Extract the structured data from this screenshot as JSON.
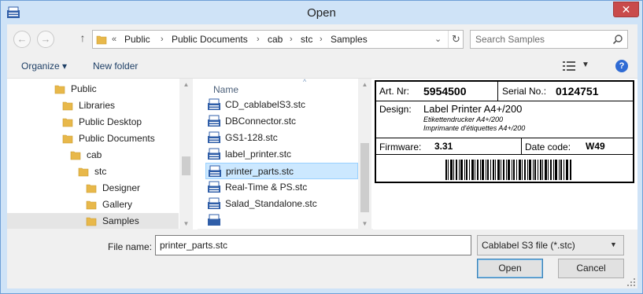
{
  "window": {
    "title": "Open",
    "close_glyph": "✕"
  },
  "address_bar": {
    "back_glyph": "←",
    "forward_glyph": "→",
    "up_glyph": "↑",
    "overflow_glyph": "«",
    "separator_glyph": "›",
    "crumbs": [
      "Public",
      "Public Documents",
      "cab",
      "stc",
      "Samples"
    ],
    "dropdown_glyph": "⌄",
    "refresh_glyph": "↻"
  },
  "search": {
    "placeholder": "Search Samples"
  },
  "toolbar": {
    "organize_label": "Organize ▾",
    "new_folder_label": "New folder",
    "view_dropdown_glyph": "▼",
    "help_glyph": "?"
  },
  "nav_tree": {
    "items": [
      {
        "label": "Public"
      },
      {
        "label": "Libraries"
      },
      {
        "label": "Public Desktop"
      },
      {
        "label": "Public Documents"
      },
      {
        "label": "cab"
      },
      {
        "label": "stc"
      },
      {
        "label": "Designer"
      },
      {
        "label": "Gallery"
      },
      {
        "label": "Samples",
        "selected": true
      }
    ],
    "scroll_up_glyph": "▲",
    "scroll_down_glyph": "▼"
  },
  "file_list": {
    "column_name": "Name",
    "sort_glyph": "^",
    "files": [
      {
        "name": "CD_cablabelS3.stc"
      },
      {
        "name": "DBConnector.stc"
      },
      {
        "name": "GS1-128.stc"
      },
      {
        "name": "label_printer.stc"
      },
      {
        "name": "printer_parts.stc",
        "selected": true
      },
      {
        "name": "Real-Time & PS.stc"
      },
      {
        "name": "Salad_Standalone.stc"
      }
    ],
    "scroll_up_glyph": "▲",
    "scroll_down_glyph": "▼"
  },
  "preview": {
    "art_label": "Art. Nr:",
    "art_value": "5954500",
    "serial_label": "Serial No.:",
    "serial_value": "0124751",
    "design_label": "Design:",
    "design_title": "Label Printer A4+/200",
    "design_de": "Etikettendrucker A4+/200",
    "design_fr": "Imprimante d'étiquettes A4+/200",
    "firmware_label": "Firmware:",
    "firmware_value": "3.31",
    "date_label": "Date code:",
    "date_value": "W49"
  },
  "bottom": {
    "file_name_label": "File name:",
    "file_name_value": "printer_parts.stc",
    "file_type_value": "Cablabel S3 file (*.stc)",
    "file_type_dropdown_glyph": "▼",
    "open_label": "Open",
    "cancel_label": "Cancel"
  },
  "colors": {
    "title_bar": "#cfe3f7",
    "close_button": "#c94b4b",
    "selection": "#cce8ff",
    "folder": "#e8b84a",
    "file_icon": "#2f5ea8"
  }
}
